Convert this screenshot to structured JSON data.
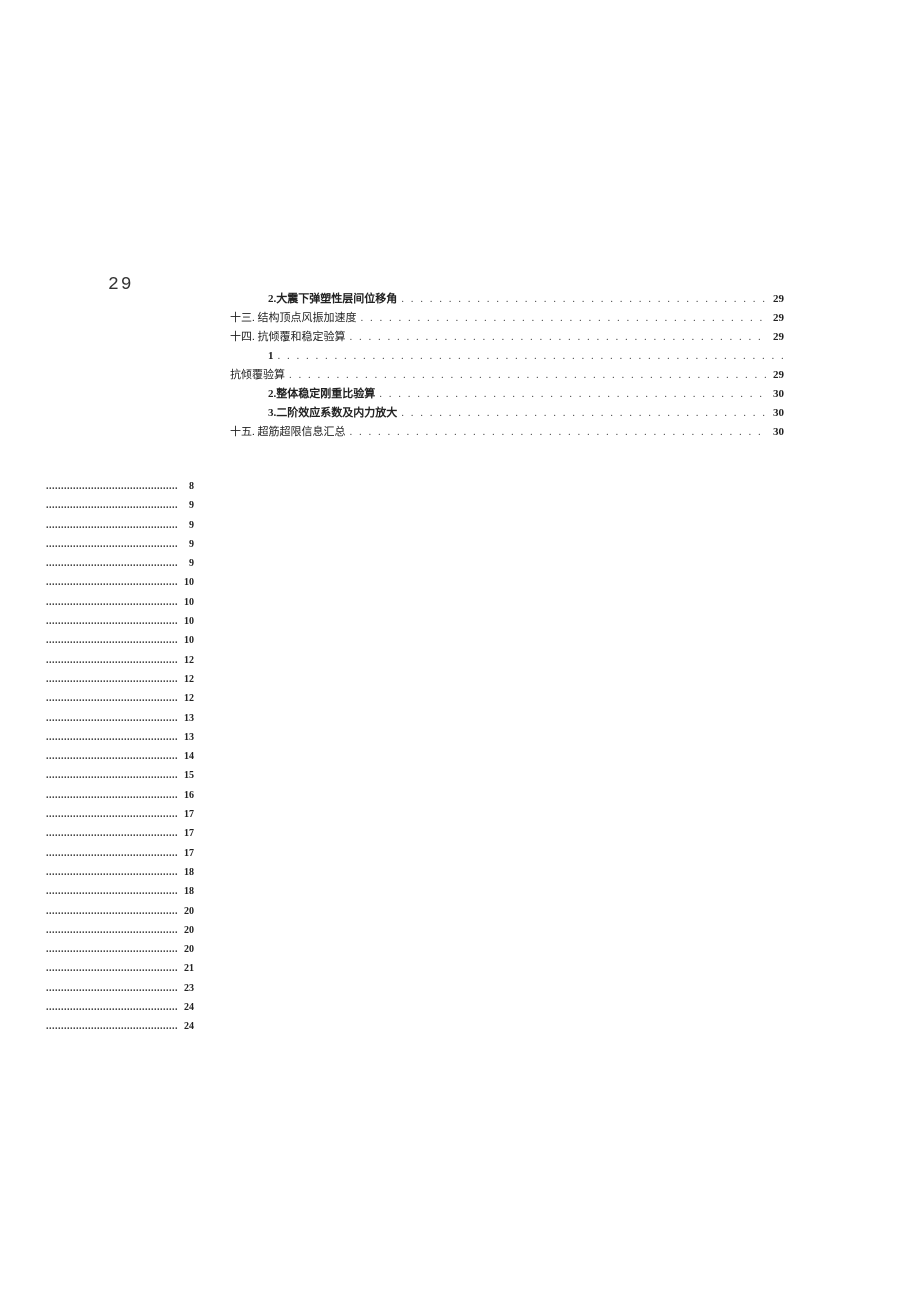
{
  "page_number": "29",
  "toc_main": [
    {
      "title": "2.大震下弹塑性层间位移角",
      "page": "29",
      "indent": 1,
      "bold": true
    },
    {
      "title": "十三. 结构顶点风振加速度",
      "page": "29",
      "indent": 0,
      "bold": false
    },
    {
      "title": "十四. 抗倾覆和稳定验算",
      "page": "29",
      "indent": 0,
      "bold": false
    },
    {
      "title": "1",
      "page": "",
      "indent": 1,
      "bold": true,
      "continuation": true
    },
    {
      "title": "抗倾覆验算",
      "page": "29",
      "indent": 0,
      "bold": false
    },
    {
      "title": "2.整体稳定刚重比验算",
      "page": "30",
      "indent": 1,
      "bold": true
    },
    {
      "title": "3.二阶效应系数及内力放大",
      "page": "30",
      "indent": 1,
      "bold": true
    },
    {
      "title": "十五. 超筋超限信息汇总",
      "page": "30",
      "indent": 0,
      "bold": false
    }
  ],
  "left_list": [
    {
      "page": "8"
    },
    {
      "page": "9"
    },
    {
      "page": "9"
    },
    {
      "page": "9"
    },
    {
      "page": "9"
    },
    {
      "page": "10"
    },
    {
      "page": "10"
    },
    {
      "page": "10"
    },
    {
      "page": "10"
    },
    {
      "page": "12"
    },
    {
      "page": "12"
    },
    {
      "page": "12"
    },
    {
      "page": "13"
    },
    {
      "page": "13"
    },
    {
      "page": "14"
    },
    {
      "page": "15"
    },
    {
      "page": "16"
    },
    {
      "page": "17"
    },
    {
      "page": "17"
    },
    {
      "page": "17"
    },
    {
      "page": "18"
    },
    {
      "page": "18"
    },
    {
      "page": "20"
    },
    {
      "page": "20"
    },
    {
      "page": "20"
    },
    {
      "page": "21"
    },
    {
      "page": "23"
    },
    {
      "page": "24"
    },
    {
      "page": "24"
    }
  ]
}
